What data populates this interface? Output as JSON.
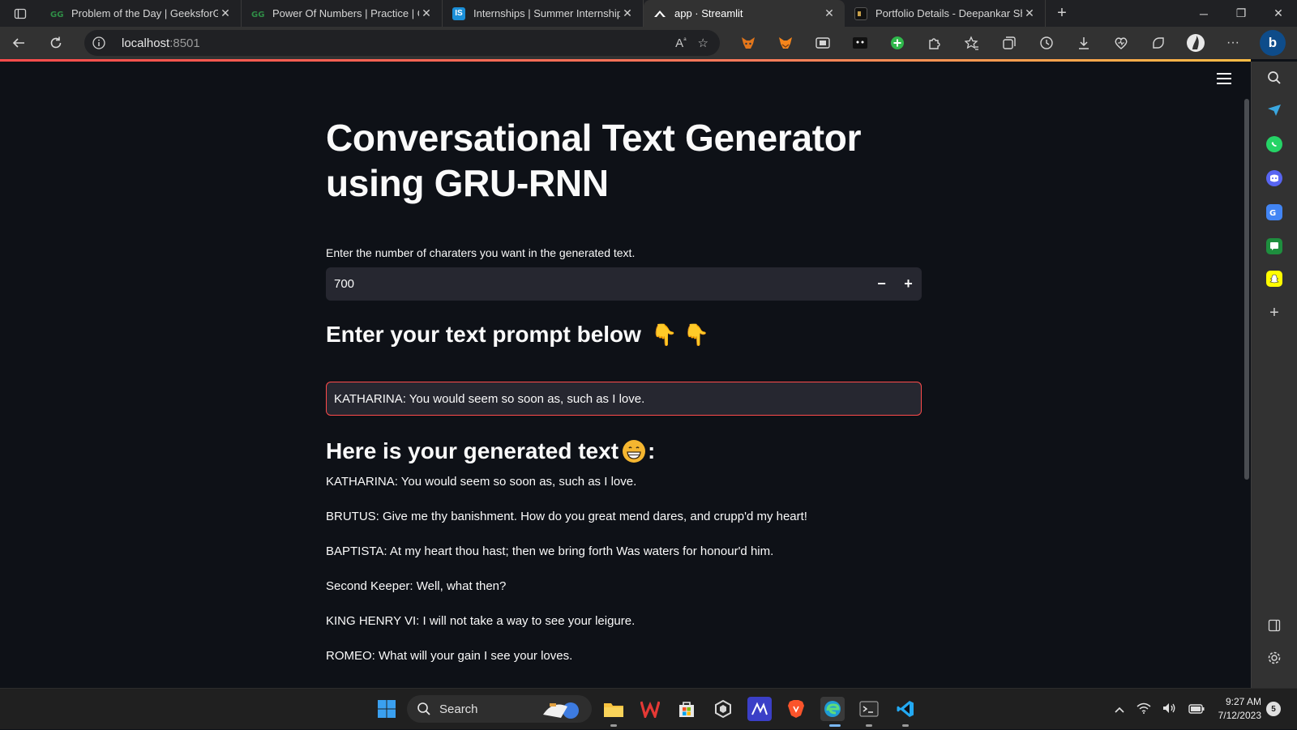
{
  "browser": {
    "tabs": [
      {
        "title": "Problem of the Day | GeeksforGe",
        "icon": "gfg-icon",
        "active": false
      },
      {
        "title": "Power Of Numbers | Practice | Ge",
        "icon": "gfg-icon",
        "active": false
      },
      {
        "title": "Internships | Summer Internship",
        "icon": "internshala-icon",
        "favicon_text": "IS",
        "active": false
      },
      {
        "title": "app · Streamlit",
        "icon": "streamlit-icon",
        "active": true
      },
      {
        "title": "Portfolio Details - Deepankar Sha",
        "icon": "portfolio-icon",
        "active": false
      }
    ],
    "url_host": "localhost",
    "url_port": ":8501",
    "accent_color": "#ff4b4b"
  },
  "app": {
    "title": "Conversational Text Generator using GRU-RNN",
    "chars_label": "Enter the number of charaters you want in the generated text.",
    "chars_value": "700",
    "decrement_label": "−",
    "increment_label": "+",
    "prompt_heading": "Enter your text prompt below",
    "prompt_heading_emoji": "👇 👇",
    "prompt_value": "KATHARINA: You would seem so soon as, such as I love.",
    "generated_heading": "Here is your generated text",
    "generated_heading_suffix": ":",
    "generated_lines": [
      "KATHARINA: You would seem so soon as, such as I love.",
      "BRUTUS: Give me thy banishment. How do you great mend dares, and crupp'd my heart!",
      "BAPTISTA: At my heart thou hast; then we bring forth Was waters for honour'd him.",
      "Second Keeper: Well, what then?",
      "KING HENRY VI: I will not take a way to see your leigure.",
      "ROMEO: What will your gain I see your loves."
    ]
  },
  "taskbar": {
    "search_label": "Search",
    "time": "9:27 AM",
    "date": "7/12/2023",
    "notification_count": "5"
  }
}
